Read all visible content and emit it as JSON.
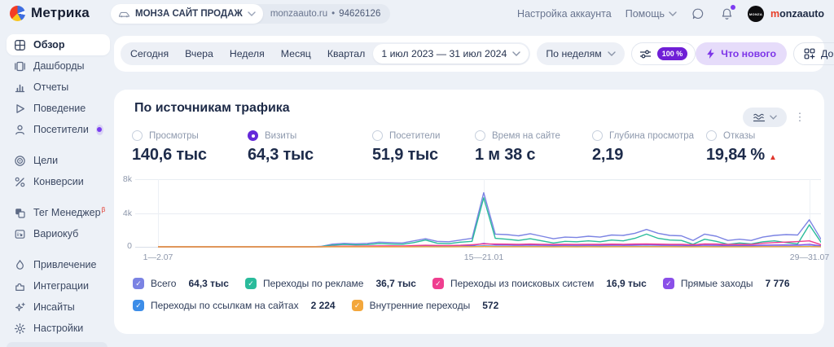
{
  "header": {
    "logo_text": "Метрика",
    "counter": {
      "name": "МОНЗА САЙТ ПРОДАЖ",
      "domain": "monzaauto.ru",
      "bullet": "•",
      "id": "94626126"
    },
    "account_settings": "Настройка аккаунта",
    "help": "Помощь",
    "avatar_text": "MONZA",
    "user_first": "m",
    "user_rest": "onzaauto"
  },
  "sidebar": {
    "items": [
      {
        "label": "Обзор",
        "active": true
      },
      {
        "label": "Дашборды"
      },
      {
        "label": "Отчеты"
      },
      {
        "label": "Поведение"
      },
      {
        "label": "Посетители",
        "badge_dot": true
      },
      {
        "label": "Цели"
      },
      {
        "label": "Конверсии"
      },
      {
        "label": "Тег Менеджер",
        "beta": "β"
      },
      {
        "label": "Вариокуб"
      },
      {
        "label": "Привлечение"
      },
      {
        "label": "Интеграции"
      },
      {
        "label": "Инсайты"
      },
      {
        "label": "Настройки"
      }
    ]
  },
  "toolbar": {
    "quick_ranges": [
      "Сегодня",
      "Вчера",
      "Неделя",
      "Месяц",
      "Квартал"
    ],
    "date_range": "1 июл 2023 — 31 июл 2024",
    "granularity": "По неделям",
    "sampling": "100 %",
    "whats_new": "Что нового",
    "add": "Добавить"
  },
  "card": {
    "title": "По источникам трафика",
    "metrics": [
      {
        "label": "Просмотры",
        "value": "140,6 тыс",
        "selected": false
      },
      {
        "label": "Визиты",
        "value": "64,3 тыс",
        "selected": true
      },
      {
        "label": "Посетители",
        "value": "51,9 тыс",
        "selected": false
      },
      {
        "label": "Время на сайте",
        "value": "1 м 38 с",
        "selected": false
      },
      {
        "label": "Глубина просмотра",
        "value": "2,19",
        "selected": false
      },
      {
        "label": "Отказы",
        "value": "19,84 %",
        "selected": false,
        "trend": "up",
        "trend_arrow": "▲"
      }
    ]
  },
  "colors": {
    "accent_purple": "#7d35e8",
    "badge_purple": "#6f1fd6",
    "alert_red": "#e0362c",
    "notification_dot": "#7d3bf0",
    "selected_radio": "#6428d9"
  },
  "chart_data": {
    "type": "line",
    "title": "По источникам трафика",
    "metric": "Визиты",
    "x_ticks": [
      "1—2.07",
      "15—21.01",
      "29—31.07"
    ],
    "x_tick_indices": [
      0,
      28,
      56
    ],
    "y_ticks": [
      "8k",
      "4k",
      "0"
    ],
    "ylim": [
      0,
      8000
    ],
    "grid": true,
    "legend_position": "bottom",
    "series": [
      {
        "name": "Всего",
        "total": "64,3 тыс",
        "color": "#7b83e3",
        "values": [
          0,
          0,
          0,
          0,
          0,
          0,
          0,
          0,
          0,
          0,
          0,
          0,
          0,
          0,
          50,
          320,
          400,
          360,
          400,
          550,
          500,
          450,
          700,
          950,
          650,
          600,
          800,
          1000,
          6400,
          1500,
          1450,
          1300,
          1550,
          1250,
          950,
          1150,
          1100,
          1250,
          1150,
          1400,
          1350,
          1600,
          2050,
          1600,
          1350,
          1300,
          750,
          1500,
          1250,
          750,
          900,
          750,
          1150,
          1350,
          1450,
          1400,
          3200,
          900
        ]
      },
      {
        "name": "Переходы по рекламе",
        "total": "36,7 тыс",
        "color": "#2abb9b",
        "values": [
          0,
          0,
          0,
          0,
          0,
          0,
          0,
          0,
          0,
          0,
          0,
          0,
          0,
          0,
          30,
          200,
          280,
          230,
          260,
          380,
          330,
          300,
          500,
          800,
          420,
          380,
          550,
          650,
          5800,
          1000,
          900,
          750,
          950,
          700,
          450,
          650,
          600,
          700,
          600,
          800,
          700,
          1000,
          1500,
          1000,
          800,
          750,
          300,
          900,
          650,
          300,
          450,
          350,
          600,
          700,
          500,
          350,
          2600,
          550
        ]
      },
      {
        "name": "Переходы из поисковых систем",
        "total": "16,9 тыс",
        "color": "#ef3e8f",
        "values": [
          0,
          0,
          0,
          0,
          0,
          0,
          0,
          0,
          0,
          0,
          0,
          0,
          0,
          0,
          10,
          60,
          80,
          80,
          90,
          110,
          120,
          100,
          140,
          180,
          160,
          150,
          180,
          250,
          350,
          330,
          320,
          300,
          330,
          300,
          280,
          300,
          280,
          300,
          290,
          320,
          300,
          330,
          350,
          320,
          300,
          300,
          250,
          350,
          330,
          280,
          300,
          280,
          420,
          500,
          560,
          620,
          700,
          250
        ]
      },
      {
        "name": "Прямые заходы",
        "total": "7 776",
        "color": "#8a4fe8",
        "values": [
          0,
          0,
          0,
          0,
          0,
          0,
          0,
          0,
          0,
          0,
          0,
          0,
          0,
          0,
          10,
          60,
          80,
          70,
          80,
          100,
          90,
          80,
          120,
          150,
          110,
          100,
          130,
          160,
          400,
          250,
          230,
          200,
          230,
          200,
          170,
          190,
          180,
          190,
          180,
          200,
          190,
          220,
          260,
          220,
          190,
          180,
          130,
          210,
          190,
          140,
          160,
          140,
          190,
          210,
          220,
          210,
          300,
          120
        ]
      },
      {
        "name": "Переходы по ссылкам на сайтах",
        "total": "2 224",
        "color": "#3d8de8",
        "values": [
          0,
          0,
          0,
          0,
          0,
          0,
          0,
          0,
          0,
          0,
          0,
          0,
          0,
          0,
          5,
          30,
          40,
          35,
          40,
          50,
          45,
          40,
          55,
          70,
          50,
          45,
          60,
          70,
          120,
          80,
          70,
          60,
          70,
          60,
          50,
          55,
          50,
          55,
          50,
          60,
          55,
          65,
          75,
          65,
          55,
          50,
          35,
          60,
          55,
          40,
          45,
          40,
          55,
          60,
          65,
          60,
          90,
          35
        ]
      },
      {
        "name": "Внутренние переходы",
        "total": "572",
        "color": "#f3a73c",
        "values": [
          0,
          0,
          0,
          0,
          0,
          0,
          0,
          0,
          0,
          0,
          0,
          0,
          0,
          0,
          2,
          8,
          10,
          9,
          10,
          12,
          11,
          10,
          14,
          18,
          13,
          12,
          15,
          18,
          40,
          20,
          18,
          16,
          18,
          16,
          13,
          15,
          14,
          15,
          14,
          16,
          15,
          17,
          20,
          17,
          15,
          14,
          9,
          16,
          14,
          10,
          12,
          10,
          15,
          16,
          17,
          16,
          25,
          9
        ]
      }
    ]
  }
}
